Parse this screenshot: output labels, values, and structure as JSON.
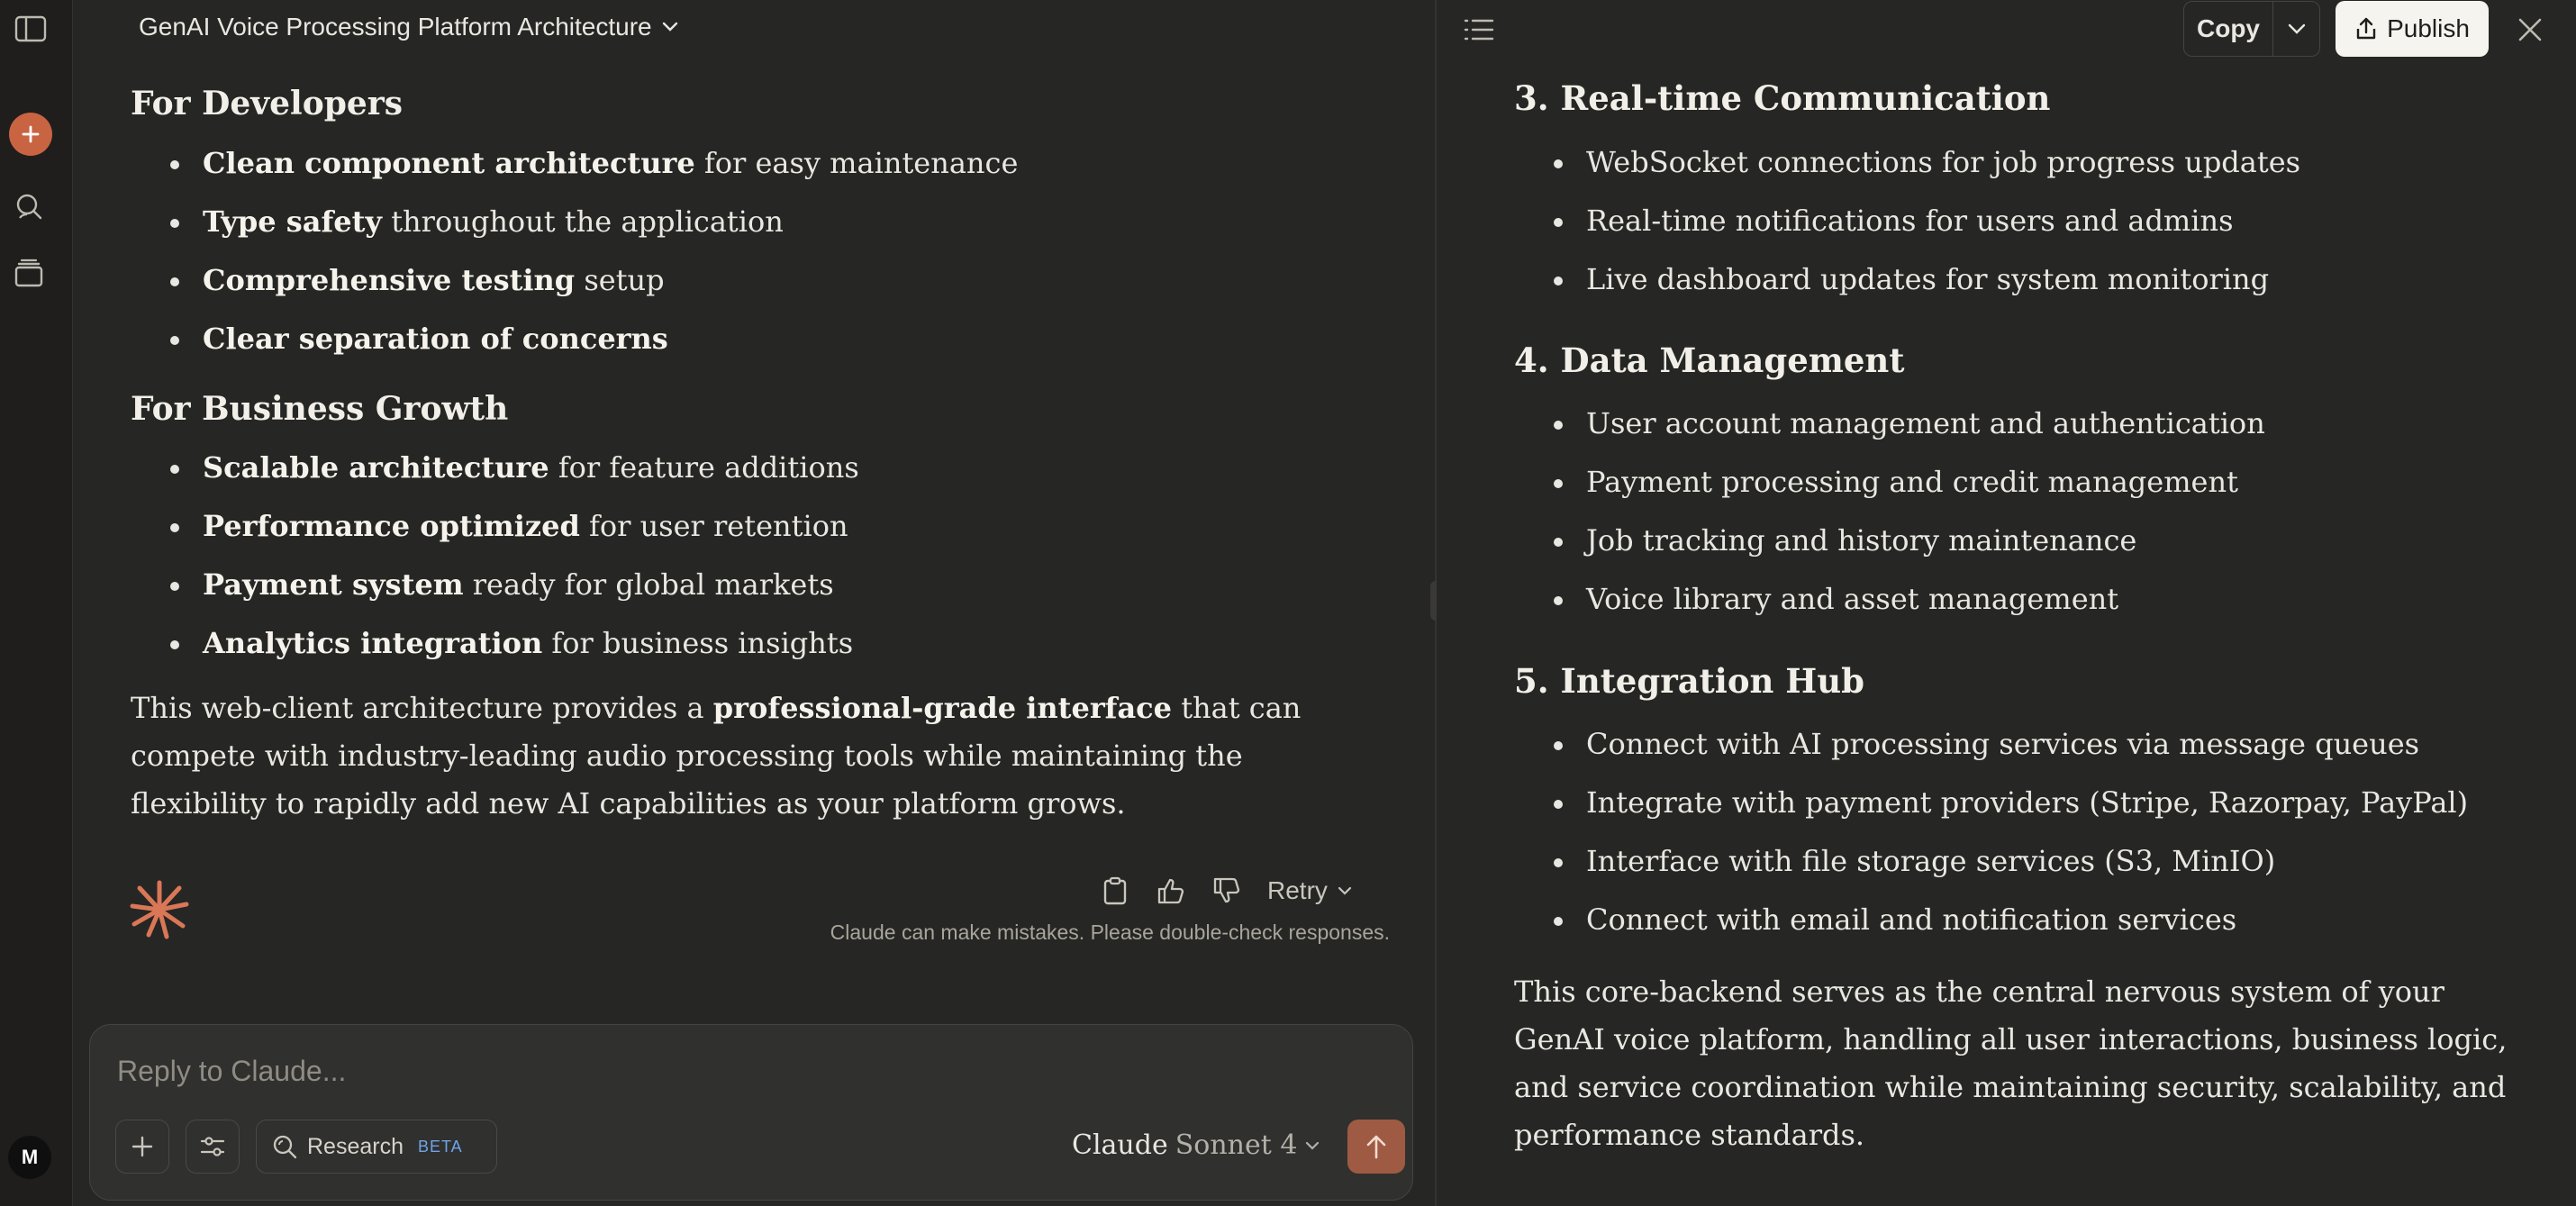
{
  "chat": {
    "title": "GenAI Voice Processing Platform Architecture",
    "sections": [
      {
        "heading": "For Developers",
        "items": [
          {
            "bold": "Clean component architecture",
            "rest": " for easy maintenance"
          },
          {
            "bold": "Type safety",
            "rest": " throughout the application"
          },
          {
            "bold": "Comprehensive testing",
            "rest": " setup"
          },
          {
            "bold": "Clear separation of concerns",
            "rest": ""
          }
        ]
      },
      {
        "heading": "For Business Growth",
        "items": [
          {
            "bold": "Scalable architecture",
            "rest": " for feature additions"
          },
          {
            "bold": "Performance optimized",
            "rest": " for user retention"
          },
          {
            "bold": "Payment system",
            "rest": " ready for global markets"
          },
          {
            "bold": "Analytics integration",
            "rest": " for business insights"
          }
        ]
      }
    ],
    "closing": {
      "pre": "This web-client architecture provides a ",
      "bold": "professional-grade interface",
      "post": " that can compete with industry-leading audio processing tools while maintaining the flexibility to rapidly add new AI capabilities as your platform grows."
    },
    "retry_label": "Retry",
    "disclaimer": "Claude can make mistakes. Please double-check responses."
  },
  "composer": {
    "placeholder": "Reply to Claude...",
    "research_label": "Research",
    "beta_badge": "BETA",
    "model_name_1": "Claude",
    "model_name_2": "Sonnet 4"
  },
  "user": {
    "initial": "M"
  },
  "artifact": {
    "copy_label": "Copy",
    "publish_label": "Publish",
    "sections": [
      {
        "heading": "3. Real-time Communication",
        "items": [
          "WebSocket connections for job progress updates",
          "Real-time notifications for users and admins",
          "Live dashboard updates for system monitoring"
        ]
      },
      {
        "heading": "4. Data Management",
        "items": [
          "User account management and authentication",
          "Payment processing and credit management",
          "Job tracking and history maintenance",
          "Voice library and asset management"
        ]
      },
      {
        "heading": "5. Integration Hub",
        "items": [
          "Connect with AI processing services via message queues",
          "Integrate with payment providers (Stripe, Razorpay, PayPal)",
          "Interface with file storage services (S3, MinIO)",
          "Connect with email and notification services"
        ]
      }
    ],
    "closing": "This core-backend serves as the central nervous system of your GenAI voice platform, handling all user interactions, business logic, and service coordination while maintaining security, scalability, and performance standards."
  },
  "colors": {
    "accent": "#c96442",
    "background": "#262624",
    "sidebar": "#1f1e1d",
    "beta": "#6fa4e8"
  },
  "icons": [
    "sidebar-toggle-icon",
    "plus-icon",
    "search-icon",
    "archive-icon",
    "chevron-down-icon",
    "clipboard-icon",
    "thumbs-up-icon",
    "thumbs-down-icon",
    "sliders-icon",
    "arrow-up-icon",
    "list-icon",
    "share-icon",
    "close-icon",
    "claude-spark-icon"
  ]
}
